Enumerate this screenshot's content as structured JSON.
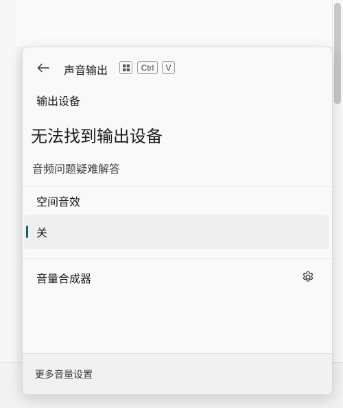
{
  "panel": {
    "title": "声音输出",
    "shortcut_keys": [
      "Ctrl",
      "V"
    ],
    "output_device_label": "输出设备",
    "no_device_message": "无法找到输出设备",
    "troubleshoot_link": "音频问题疑难解答",
    "spatial_audio_label": "空间音效",
    "spatial_audio_selected": "关",
    "volume_mixer_label": "音量合成器",
    "more_settings_link": "更多音量设置"
  },
  "icons": {
    "back": "back-arrow-icon",
    "windows_key": "windows-key-icon",
    "settings": "gear-icon"
  },
  "colors": {
    "accent": "#1c5f6e",
    "panel_bg": "#f9f9f9",
    "selected_row_bg": "#efefef"
  }
}
